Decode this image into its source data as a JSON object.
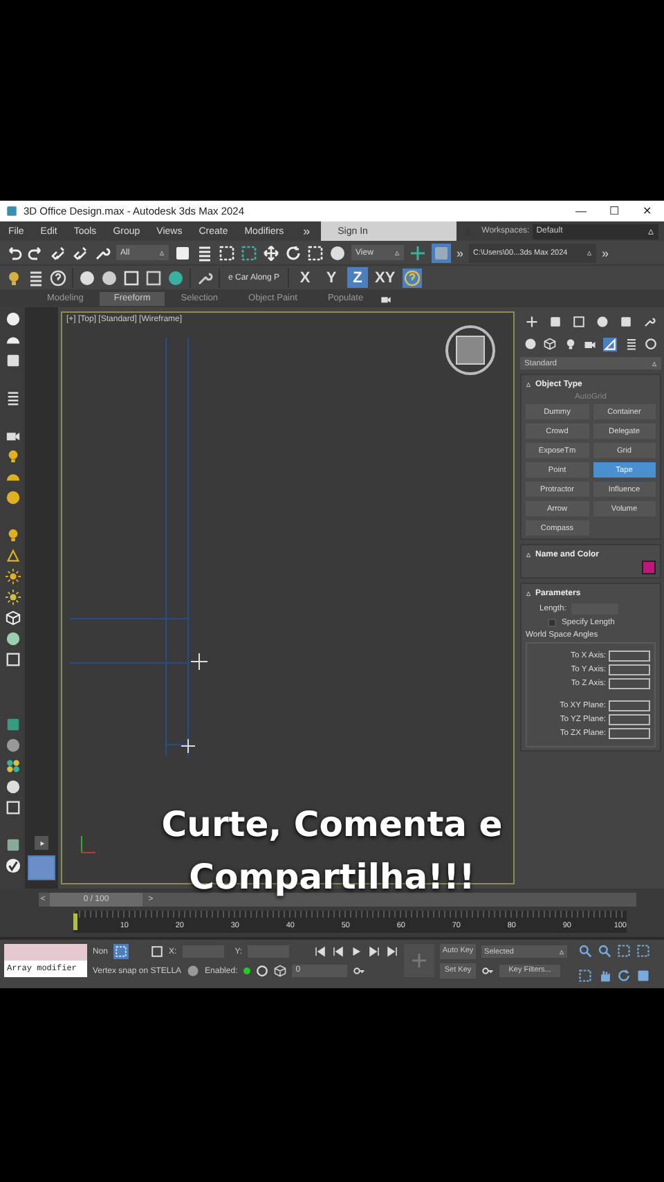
{
  "window": {
    "title": "3D Office Design.max - Autodesk 3ds Max 2024",
    "controls": [
      "—",
      "☐",
      "✕"
    ]
  },
  "menu": {
    "items": [
      "File",
      "Edit",
      "Tools",
      "Group",
      "Views",
      "Create",
      "Modifiers"
    ],
    "overflow": "»",
    "sign_in": "Sign In",
    "workspaces_label": "Workspaces:",
    "workspace": "Default"
  },
  "toolbar": {
    "selection_filter": "All",
    "reference_coord": "View",
    "overflow": "»",
    "project_path": "C:\\Users\\00...3ds Max 2024",
    "path_overflow": "»",
    "named_set": "e Car Along P",
    "axes": [
      {
        "label": "X",
        "selected": false
      },
      {
        "label": "Y",
        "selected": false
      },
      {
        "label": "Z",
        "selected": true
      },
      {
        "label": "XY",
        "selected": false
      }
    ]
  },
  "ribbon_tabs": [
    {
      "label": "Modeling",
      "selected": false
    },
    {
      "label": "Freeform",
      "selected": true
    },
    {
      "label": "Selection",
      "selected": false
    },
    {
      "label": "Object Paint",
      "selected": false
    },
    {
      "label": "Populate",
      "selected": false
    }
  ],
  "viewport": {
    "label": "[+] [Top] [Standard] [Wireframe]"
  },
  "caption": [
    "Curte, Comenta e",
    "Compartilha!!!"
  ],
  "command_panel": {
    "category": "Standard",
    "object_type": {
      "title": "Object Type",
      "autogrid": {
        "label": "AutoGrid",
        "disabled": true
      },
      "buttons": [
        {
          "label": "Dummy",
          "selected": false
        },
        {
          "label": "Container",
          "selected": false
        },
        {
          "label": "Crowd",
          "selected": false
        },
        {
          "label": "Delegate",
          "selected": false
        },
        {
          "label": "ExposeTm",
          "selected": false
        },
        {
          "label": "Grid",
          "selected": false
        },
        {
          "label": "Point",
          "selected": false
        },
        {
          "label": "Tape",
          "selected": true
        },
        {
          "label": "Protractor",
          "selected": false
        },
        {
          "label": "Influence",
          "selected": false
        },
        {
          "label": "Arrow",
          "selected": false
        },
        {
          "label": "Volume",
          "selected": false
        },
        {
          "label": "Compass",
          "selected": false
        }
      ]
    },
    "name_and_color": {
      "title": "Name and Color",
      "color": "#c0157a"
    },
    "parameters": {
      "title": "Parameters",
      "length_label": "Length:",
      "specify_length": {
        "label": "Specify Length",
        "checked": false
      },
      "group_title": "World Space Angles",
      "angles": [
        "To X Axis:",
        "To Y Axis:",
        "To Z Axis:"
      ],
      "planes": [
        "To XY Plane:",
        "To YZ Plane:",
        "To ZX Plane:"
      ]
    }
  },
  "timeline": {
    "prev": "<",
    "next": ">",
    "frame": "0 / 100",
    "level": 0,
    "ticks": [
      "10",
      "20",
      "30",
      "40",
      "50",
      "60",
      "70",
      "80",
      "90",
      "100"
    ]
  },
  "status": {
    "listener": "Array modifier",
    "selection": "Non",
    "x_label": "X:",
    "y_label": "Y:",
    "prompt": "Vertex snap on STELLA",
    "enabled_label": "Enabled:",
    "frame": "0",
    "auto_key": "Auto Key",
    "key_mode": "Selected",
    "set_key": "Set Key",
    "key_filters": "Key Filters..."
  }
}
